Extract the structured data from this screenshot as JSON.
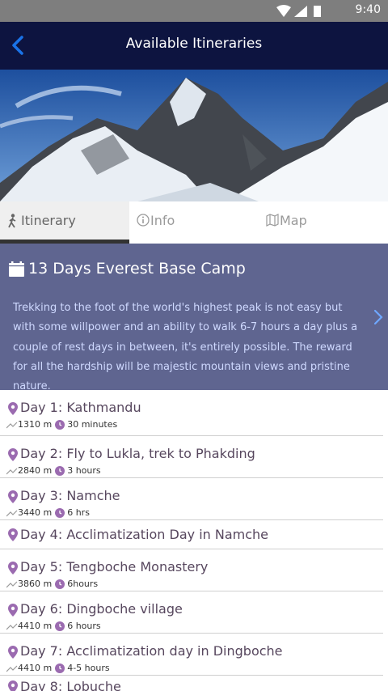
{
  "status": {
    "time": "9:40"
  },
  "header": {
    "title": "Available Itineraries"
  },
  "tabs": [
    {
      "label": "Itinerary",
      "icon": "hiker-icon"
    },
    {
      "label": "Info",
      "icon": "info-icon"
    },
    {
      "label": "Map",
      "icon": "map-icon"
    }
  ],
  "trip": {
    "title": "13 Days Everest Base Camp",
    "description": "Trekking to the foot of the world's highest peak is not easy but with some willpower and an ability to walk 6-7 hours a day plus a couple of rest days in between, it's entirely possible. The reward for all the hardship will be majestic mountain views and pristine nature."
  },
  "days": [
    {
      "title": "Day 1: Kathmandu",
      "altitude": "1310 m",
      "duration": "30 minutes"
    },
    {
      "title": "Day 2: Fly to Lukla, trek to Phakding",
      "altitude": "2840 m",
      "duration": "3 hours"
    },
    {
      "title": "Day 3: Namche",
      "altitude": "3440 m",
      "duration": "6 hrs"
    },
    {
      "title": "Day 4: Acclimatization Day in Namche"
    },
    {
      "title": "Day 5: Tengboche Monastery",
      "altitude": "3860 m",
      "duration": "6hours"
    },
    {
      "title": "Day 6:  Dingboche village",
      "altitude": "4410 m",
      "duration": "6 hours"
    },
    {
      "title": "Day 7: Acclimatization day in Dingboche",
      "altitude": "4410 m",
      "duration": "4-5 hours"
    },
    {
      "title": "Day 8: Lobuche"
    }
  ],
  "colors": {
    "appbar": "#0d1440",
    "accent": "#1a73e8",
    "card": "#5f6590",
    "pin": "#9b6bb0"
  }
}
